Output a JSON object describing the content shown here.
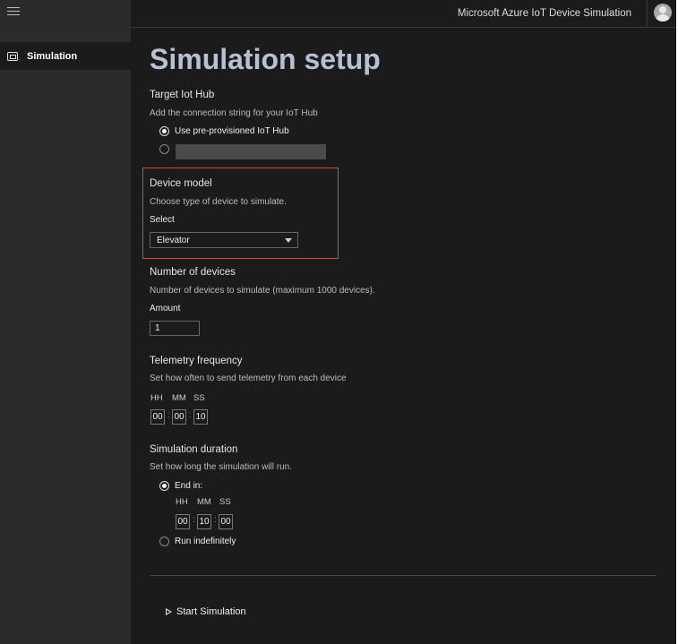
{
  "app": {
    "title": "Microsoft Azure IoT Device Simulation"
  },
  "sidebar": {
    "items": [
      {
        "label": "Simulation",
        "icon": "simulation-icon"
      }
    ]
  },
  "page": {
    "title": "Simulation setup"
  },
  "target_hub": {
    "title": "Target Iot Hub",
    "description": "Add the connection string for your IoT Hub",
    "option_preprovisioned": "Use pre-provisioned IoT Hub",
    "selected": "preprovisioned"
  },
  "device_model": {
    "title": "Device model",
    "description": "Choose type of device to simulate.",
    "select_label": "Select",
    "selected_value": "Elevator",
    "highlight_color": "#e4452a"
  },
  "devices": {
    "title": "Number of devices",
    "description": "Number of devices to simulate (maximum 1000 devices).",
    "amount_label": "Amount",
    "amount_value": "1"
  },
  "telemetry": {
    "title": "Telemetry frequency",
    "description": "Set how often to send telemetry from each device",
    "hh_label": "HH",
    "mm_label": "MM",
    "ss_label": "SS",
    "hh": "00",
    "mm": "00",
    "ss": "10"
  },
  "duration": {
    "title": "Simulation duration",
    "description": "Set how long the simulation will run.",
    "end_in_label": "End in:",
    "hh_label": "HH",
    "mm_label": "MM",
    "ss_label": "SS",
    "hh": "00",
    "mm": "10",
    "ss": "00",
    "indefinite_label": "Run indefinitely",
    "selected": "end_in"
  },
  "actions": {
    "start_label": "Start Simulation"
  },
  "colors": {
    "accent_title": "#b6c2d3",
    "background": "#1b1b1b",
    "sidebar": "#2b2b2b"
  }
}
